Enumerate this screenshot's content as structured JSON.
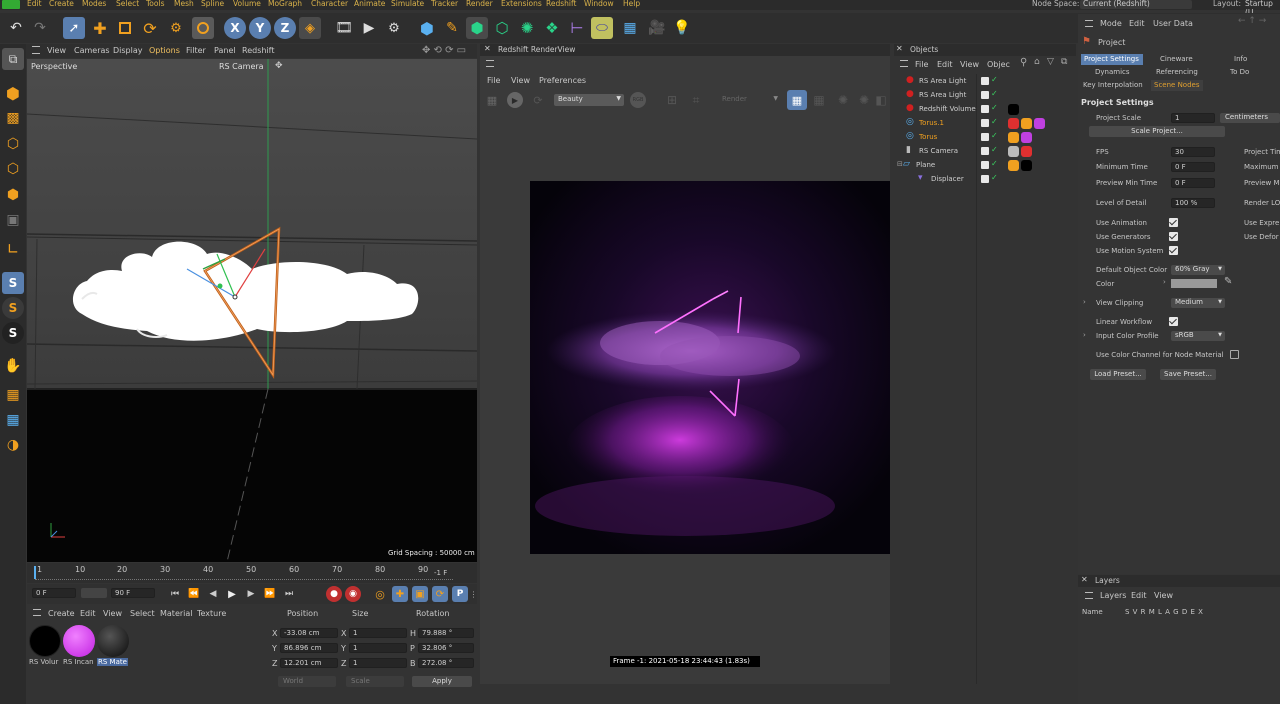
{
  "menubar": {
    "items": [
      "Edit",
      "Create",
      "Modes",
      "Select",
      "Tools",
      "Mesh",
      "Spline",
      "Volume",
      "MoGraph",
      "Character",
      "Animate",
      "Simulate",
      "Tracker",
      "Render",
      "Extensions",
      "Redshift",
      "Window",
      "Help"
    ],
    "node_space_label": "Node Space:",
    "node_space_value": "Current (Redshift)",
    "layout_label": "Layout:",
    "layout_value": "Startup (U"
  },
  "viewport": {
    "menu": [
      "View",
      "Cameras",
      "Display",
      "Options",
      "Filter",
      "Panel",
      "Redshift"
    ],
    "label": "Perspective",
    "camera": "RS Camera",
    "grid_spacing": "Grid Spacing : 50000 cm"
  },
  "timeline": {
    "ticks": [
      "1",
      "10",
      "20",
      "30",
      "40",
      "50",
      "60",
      "70",
      "80",
      "90"
    ],
    "end_frame": "-1 F",
    "current_frame": "0 F",
    "max_frame": "90 F"
  },
  "materials": {
    "menu": [
      "Create",
      "Edit",
      "View",
      "Select",
      "Material",
      "Texture"
    ],
    "items": [
      {
        "name": "RS Volur",
        "color": "#000000"
      },
      {
        "name": "RS Incan",
        "color": "#e040f0"
      },
      {
        "name": "RS Mate",
        "color": "#202020"
      }
    ]
  },
  "coords": {
    "headers": [
      "Position",
      "Size",
      "Rotation"
    ],
    "rows": [
      {
        "axis": "X",
        "pos": "-33.08 cm",
        "size": "1",
        "rlabel": "H",
        "rot": "79.888 °"
      },
      {
        "axis": "Y",
        "pos": "86.896 cm",
        "size": "1",
        "rlabel": "P",
        "rot": "32.806 °"
      },
      {
        "axis": "Z",
        "pos": "12.201 cm",
        "size": "1",
        "rlabel": "B",
        "rot": "272.08 °"
      }
    ],
    "mode1": "World",
    "mode2": "Scale",
    "apply": "Apply"
  },
  "renderview": {
    "title": "Redshift RenderView",
    "menu": [
      "File",
      "View",
      "Preferences"
    ],
    "aov": "Beauty",
    "aov2": "RGB",
    "render_select": "Render",
    "status": "Frame -1: 2021-05-18 23:44:43 (1.83s)"
  },
  "objects": {
    "title": "Objects",
    "menu": [
      "File",
      "Edit",
      "View",
      "Objec"
    ],
    "items": [
      {
        "name": "RS Area Light",
        "color": "#cfcfcf"
      },
      {
        "name": "RS Area Light",
        "color": "#cfcfcf"
      },
      {
        "name": "Redshift Volume",
        "color": "#cfcfcf"
      },
      {
        "name": "Torus.1",
        "color": "#f0a020"
      },
      {
        "name": "Torus",
        "color": "#f0a020"
      },
      {
        "name": "RS Camera",
        "color": "#cfcfcf"
      },
      {
        "name": "Plane",
        "color": "#cfcfcf"
      },
      {
        "name": "Displacer",
        "color": "#cfcfcf"
      }
    ]
  },
  "attributes": {
    "menu": [
      "Mode",
      "Edit",
      "User Data"
    ],
    "object": "Project",
    "tabs": [
      "Project Settings",
      "Cineware",
      "Info",
      "Dynamics",
      "Referencing",
      "To Do",
      "Key Interpolation",
      "Scene Nodes"
    ],
    "section": "Project Settings",
    "project_scale_label": "Project Scale",
    "project_scale_value": "1",
    "project_scale_unit": "Centimeters",
    "scale_project": "Scale Project...",
    "fps_label": "FPS",
    "fps": "30",
    "min_time_label": "Minimum Time",
    "min_time": "0 F",
    "preview_min_label": "Preview Min Time",
    "preview_min": "0 F",
    "lod_label": "Level of Detail",
    "lod": "100 %",
    "right_labels": [
      "Project Tim",
      "Maximum",
      "Preview M",
      "Render LO",
      "Use Expre",
      "Use Defor"
    ],
    "use_animation": "Use Animation",
    "use_generators": "Use Generators",
    "use_motion": "Use Motion System",
    "default_color_label": "Default Object Color",
    "default_color": "60% Gray",
    "color_label": "Color",
    "view_clipping_label": "View Clipping",
    "view_clipping": "Medium",
    "linear_workflow": "Linear Workflow",
    "input_profile_label": "Input Color Profile",
    "input_profile": "sRGB",
    "color_channel": "Use Color Channel for Node Material",
    "load_preset": "Load Preset...",
    "save_preset": "Save Preset..."
  },
  "layers": {
    "title": "Layers",
    "menu": [
      "Layers",
      "Edit",
      "View"
    ],
    "name_col": "Name",
    "cols": "S V R M L A G D E X"
  }
}
